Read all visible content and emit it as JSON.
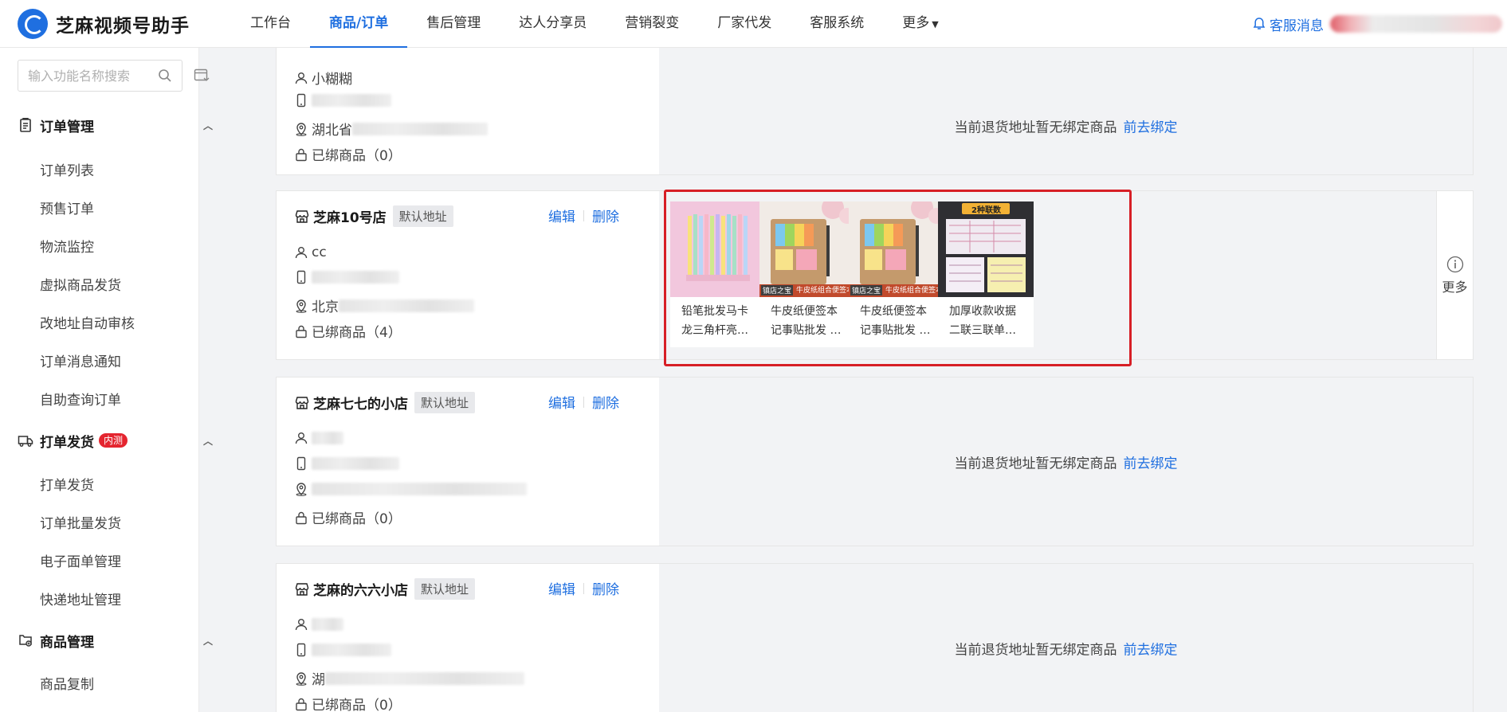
{
  "app": {
    "title": "芝麻视频号助手"
  },
  "nav": {
    "items": [
      "工作台",
      "商品/订单",
      "售后管理",
      "达人分享员",
      "营销裂变",
      "厂家代发",
      "客服系统",
      "更多"
    ],
    "active_index": 1
  },
  "header": {
    "service_msg": "客服消息"
  },
  "sidebar": {
    "search_placeholder": "输入功能名称搜索",
    "groups": [
      {
        "title": "订单管理",
        "items": [
          "订单列表",
          "预售订单",
          "物流监控",
          "虚拟商品发货",
          "改地址自动审核",
          "订单消息通知",
          "自助查询订单"
        ]
      },
      {
        "title": "打单发货",
        "badge": "内测",
        "items": [
          "打单发货",
          "订单批量发货",
          "电子面单管理",
          "快递地址管理"
        ]
      },
      {
        "title": "商品管理",
        "items": [
          "商品复制"
        ]
      }
    ]
  },
  "labels": {
    "edit": "编辑",
    "delete": "删除",
    "default_tag": "默认地址",
    "empty_tip": "当前退货地址暂无绑定商品",
    "go_bind": "前去绑定",
    "more": "更多"
  },
  "cards": [
    {
      "contact": "小糊糊",
      "address_prefix": "湖北省",
      "bound": "已绑商品（0）"
    },
    {
      "store": "芝麻10号店",
      "contact": "cc",
      "address_prefix": "北京",
      "bound": "已绑商品（4）",
      "products": [
        {
          "name": "铅笔批发马卡龙三角杆亮…"
        },
        {
          "name": "牛皮纸便签本记事贴批发 …",
          "img_caption": "镇店之宝",
          "img_banner": "牛皮纸组合便签本"
        },
        {
          "name": "牛皮纸便签本记事贴批发 …",
          "img_caption": "镇店之宝",
          "img_banner": "牛皮纸组合便签本"
        },
        {
          "name": "加厚收款收据二联三联单…",
          "img_banner": "2种联数"
        }
      ]
    },
    {
      "store": "芝麻七七的小店",
      "contact": "",
      "address_prefix": "",
      "bound": "已绑商品（0）"
    },
    {
      "store": "芝麻的六六小店",
      "contact": "",
      "address_prefix": "湖",
      "bound": "已绑商品（0）"
    }
  ],
  "colors": {
    "accent": "#1f6fe0",
    "highlight": "#d71f26",
    "badge": "#e4252f"
  }
}
